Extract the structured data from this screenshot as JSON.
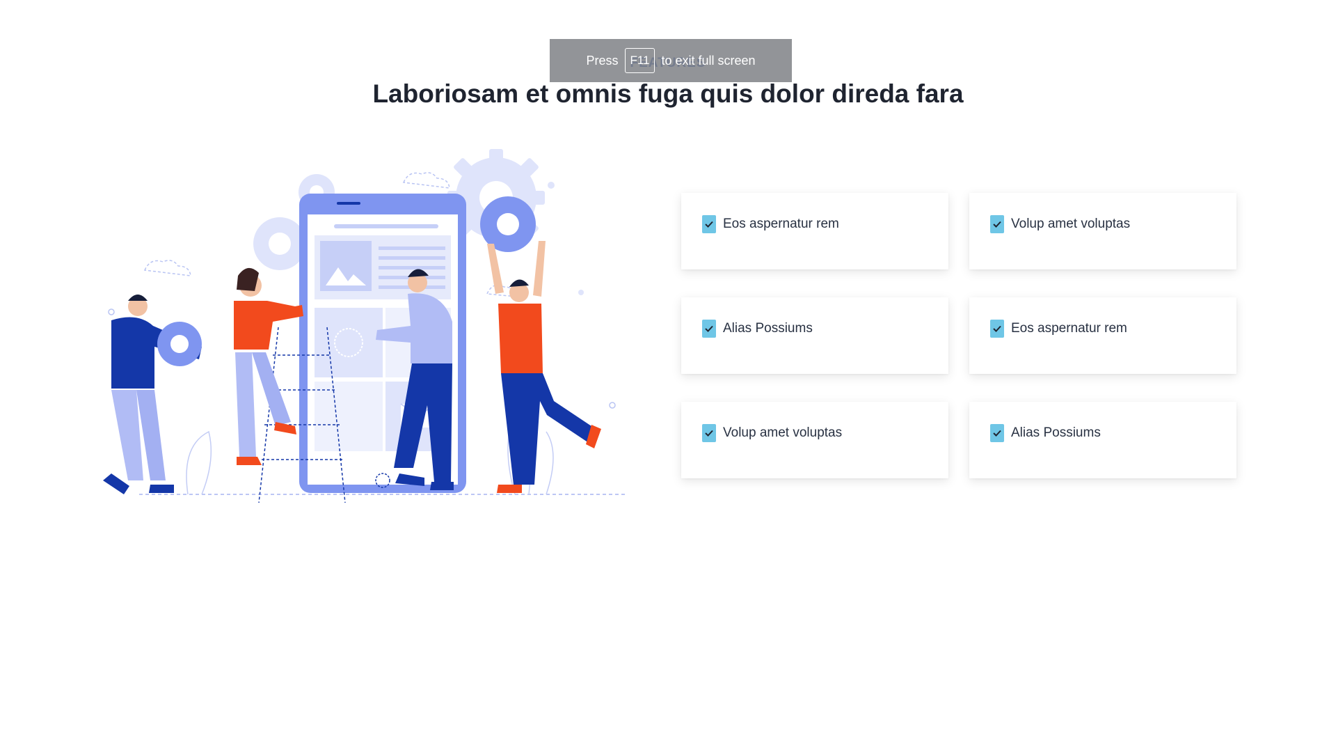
{
  "section": {
    "eyebrow": "FEATURES",
    "title": "Laboriosam et omnis fuga quis dolor direda fara"
  },
  "fullscreen_toast": {
    "press": "Press",
    "key": "F11",
    "message": "to exit full screen"
  },
  "features": [
    {
      "label": "Eos aspernatur rem",
      "icon": "check-icon"
    },
    {
      "label": "Volup amet voluptas",
      "icon": "check-icon"
    },
    {
      "label": "Alias Possiums",
      "icon": "check-icon"
    },
    {
      "label": "Eos aspernatur rem",
      "icon": "check-icon"
    },
    {
      "label": "Volup amet voluptas",
      "icon": "check-icon"
    },
    {
      "label": "Alias Possiums",
      "icon": "check-icon"
    }
  ],
  "colors": {
    "accent_blue": "#2c55b8",
    "check_bg": "#6fc6e6",
    "illustration_primary": "#7f95f0",
    "illustration_light": "#dfe4fb",
    "illustration_orange": "#f24a1d",
    "illustration_navy": "#1437a8"
  }
}
